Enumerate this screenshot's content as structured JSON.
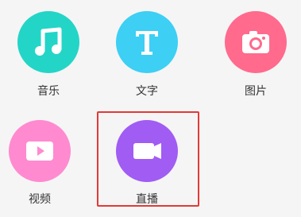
{
  "items": [
    {
      "id": "music",
      "label": "音乐",
      "icon": "music-note-icon",
      "color": "#23d5c7"
    },
    {
      "id": "text",
      "label": "文字",
      "icon": "letter-t-icon",
      "color": "#3dcff4"
    },
    {
      "id": "image",
      "label": "图片",
      "icon": "camera-icon",
      "color": "#ff6a8d"
    },
    {
      "id": "video",
      "label": "视频",
      "icon": "play-icon",
      "color": "#ff8ad0"
    },
    {
      "id": "live",
      "label": "直播",
      "icon": "video-camera-icon",
      "color": "#a15cf3"
    }
  ],
  "selection": {
    "target": "live",
    "color": "#e53935"
  }
}
